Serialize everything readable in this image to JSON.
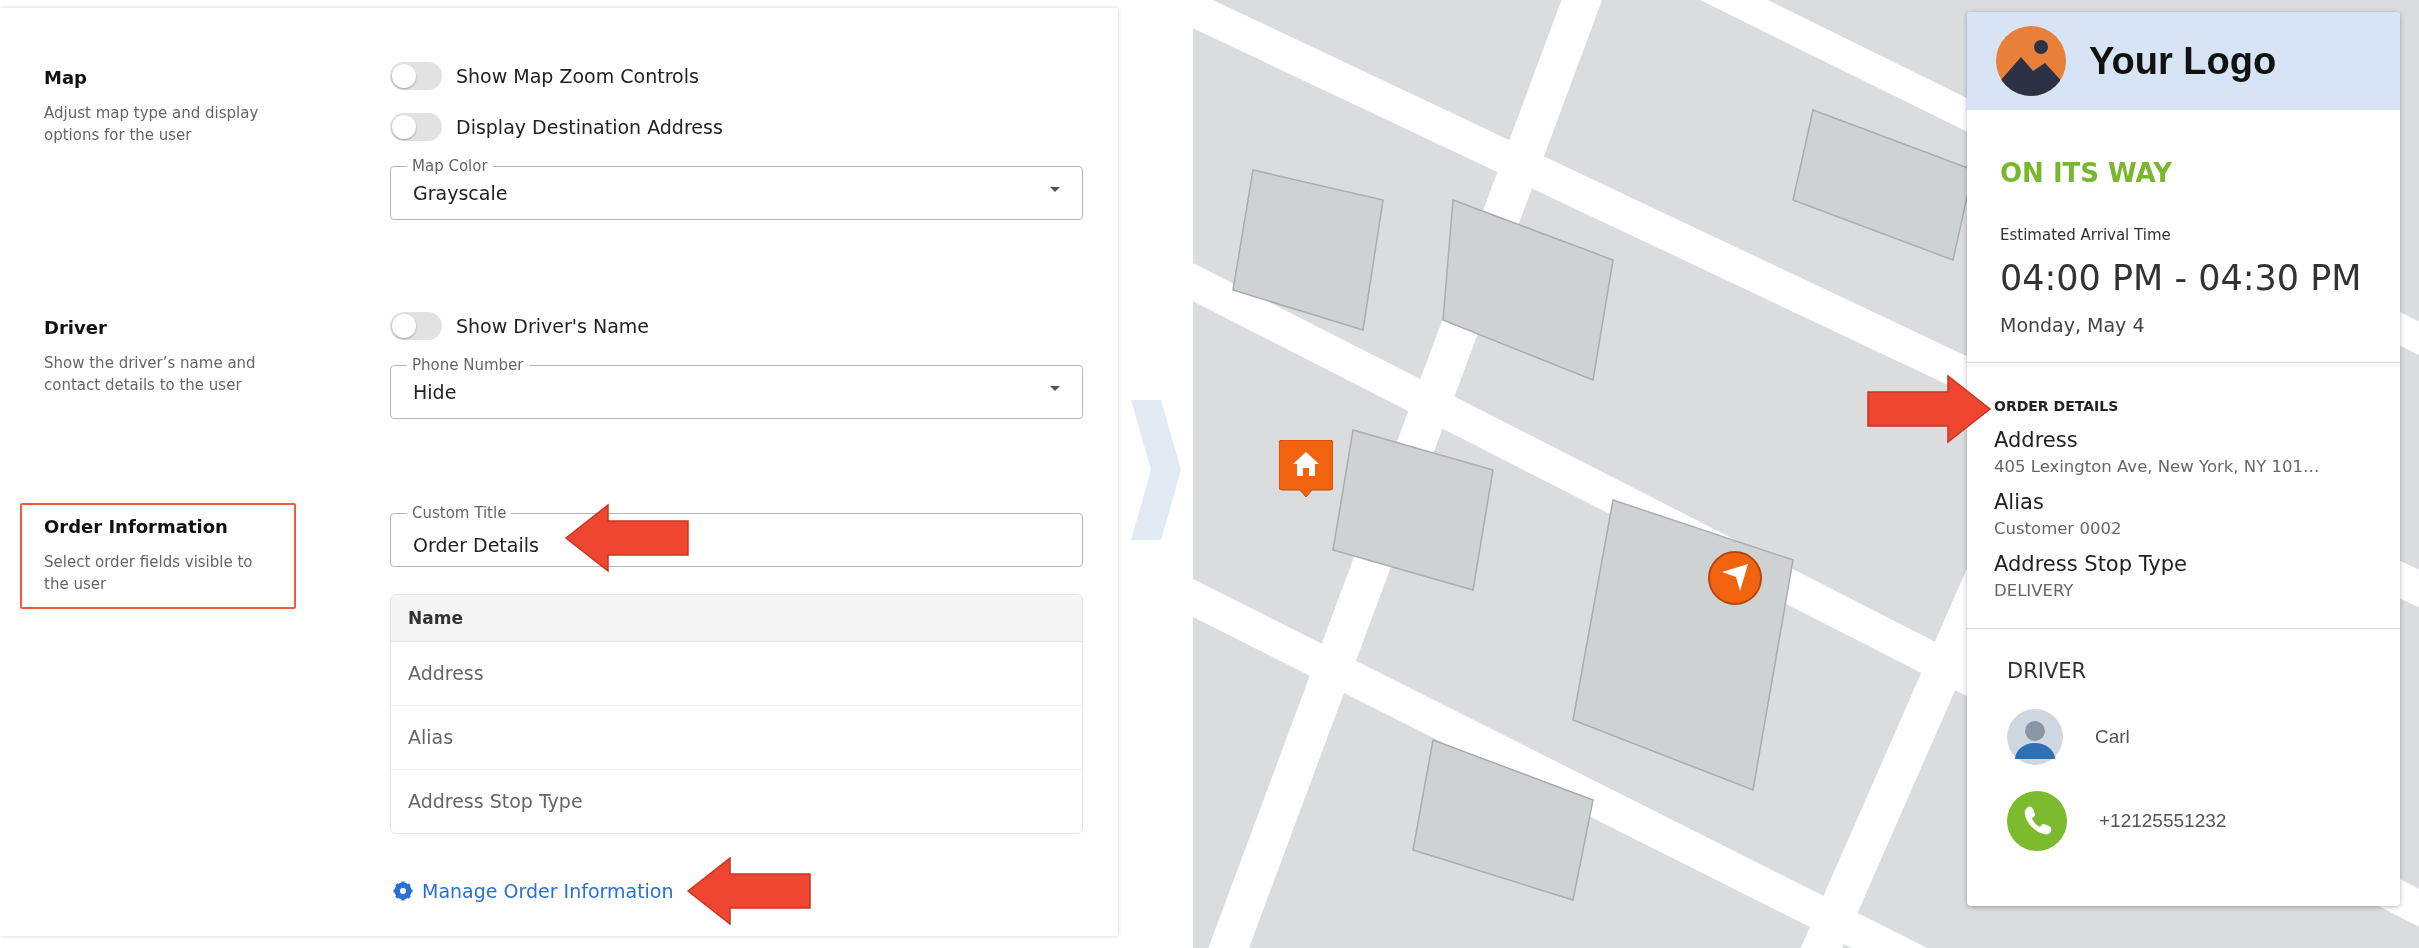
{
  "settings": {
    "sections": [
      {
        "title": "Map",
        "description": "Adjust map type and display options for the user",
        "highlighted": false,
        "toggles": [
          {
            "label": "Show Map Zoom Controls",
            "on": false
          },
          {
            "label": "Display Destination Address",
            "on": false
          }
        ],
        "select": {
          "label": "Map Color",
          "value": "Grayscale"
        }
      },
      {
        "title": "Driver",
        "description": "Show the driver’s name and contact details to the user",
        "highlighted": false,
        "toggles": [
          {
            "label": "Show Driver's Name",
            "on": false
          }
        ],
        "select": {
          "label": "Phone Number",
          "value": "Hide"
        }
      },
      {
        "title": "Order Information",
        "description": "Select order fields visible to the user",
        "highlighted": true,
        "text_field": {
          "label": "Custom Title",
          "value": "Order Details",
          "callout_arrow": true
        },
        "table": {
          "columns": [
            "Name"
          ],
          "rows": [
            "Address",
            "Alias",
            "Address Stop Type"
          ]
        },
        "link": {
          "label": "Manage Order Information",
          "callout_arrow": true
        }
      }
    ]
  },
  "tracking_card": {
    "logo_text": "Your Logo",
    "status": "ON ITS WAY",
    "eta_label": "Estimated Arrival Time",
    "eta": "04:00 PM - 04:30 PM",
    "date": "Monday, May 4",
    "order_details": {
      "title": "ORDER DETAILS",
      "callout_arrow": true,
      "fields": [
        {
          "label": "Address",
          "value": "405 Lexington Ave, New York, NY 101…"
        },
        {
          "label": "Alias",
          "value": "Customer 0002"
        },
        {
          "label": "Address Stop Type",
          "value": "DELIVERY"
        }
      ]
    },
    "driver": {
      "title": "DRIVER",
      "name": "Carl",
      "phone": "+12125551232"
    }
  }
}
